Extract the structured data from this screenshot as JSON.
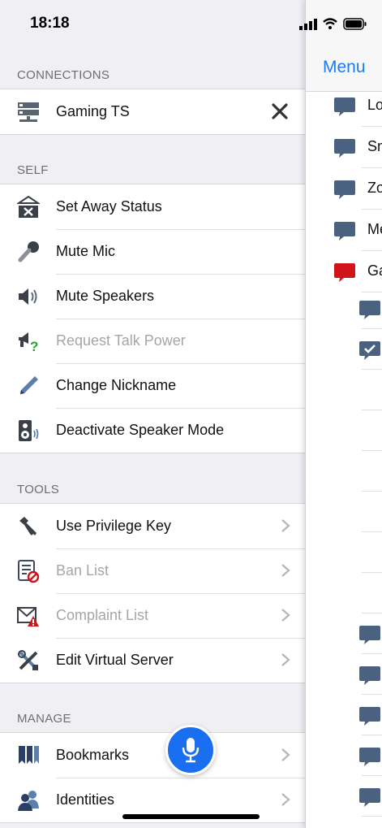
{
  "status": {
    "time": "18:18"
  },
  "sections": {
    "connections": "CONNECTIONS",
    "self": "SELF",
    "tools": "TOOLS",
    "manage": "MANAGE"
  },
  "connections": {
    "items": [
      {
        "label": "Gaming TS",
        "icon": "server-icon"
      }
    ]
  },
  "self": {
    "items": [
      {
        "label": "Set Away Status",
        "icon": "away-status-icon"
      },
      {
        "label": "Mute Mic",
        "icon": "microphone-icon"
      },
      {
        "label": "Mute Speakers",
        "icon": "speaker-icon"
      },
      {
        "label": "Request Talk Power",
        "icon": "talk-power-icon"
      },
      {
        "label": "Change Nickname",
        "icon": "pencil-icon"
      },
      {
        "label": "Deactivate Speaker Mode",
        "icon": "speaker-mode-icon"
      }
    ]
  },
  "tools": {
    "items": [
      {
        "label": "Use Privilege Key",
        "icon": "key-icon"
      },
      {
        "label": "Ban List",
        "icon": "ban-list-icon"
      },
      {
        "label": "Complaint List",
        "icon": "complaint-icon"
      },
      {
        "label": "Edit Virtual Server",
        "icon": "tools-icon"
      }
    ]
  },
  "manage": {
    "items": [
      {
        "label": "Bookmarks",
        "icon": "bookmarks-icon"
      },
      {
        "label": "Identities",
        "icon": "identities-icon"
      }
    ]
  },
  "side": {
    "menu_label": "Menu",
    "channels": [
      "Lo",
      "Sm",
      "Zo",
      "Me",
      "Ga"
    ]
  },
  "colors": {
    "accent": "#1a7cf3",
    "mic": "#1a6ff0",
    "icon": "#4a5a70",
    "alert": "#d0141a"
  }
}
